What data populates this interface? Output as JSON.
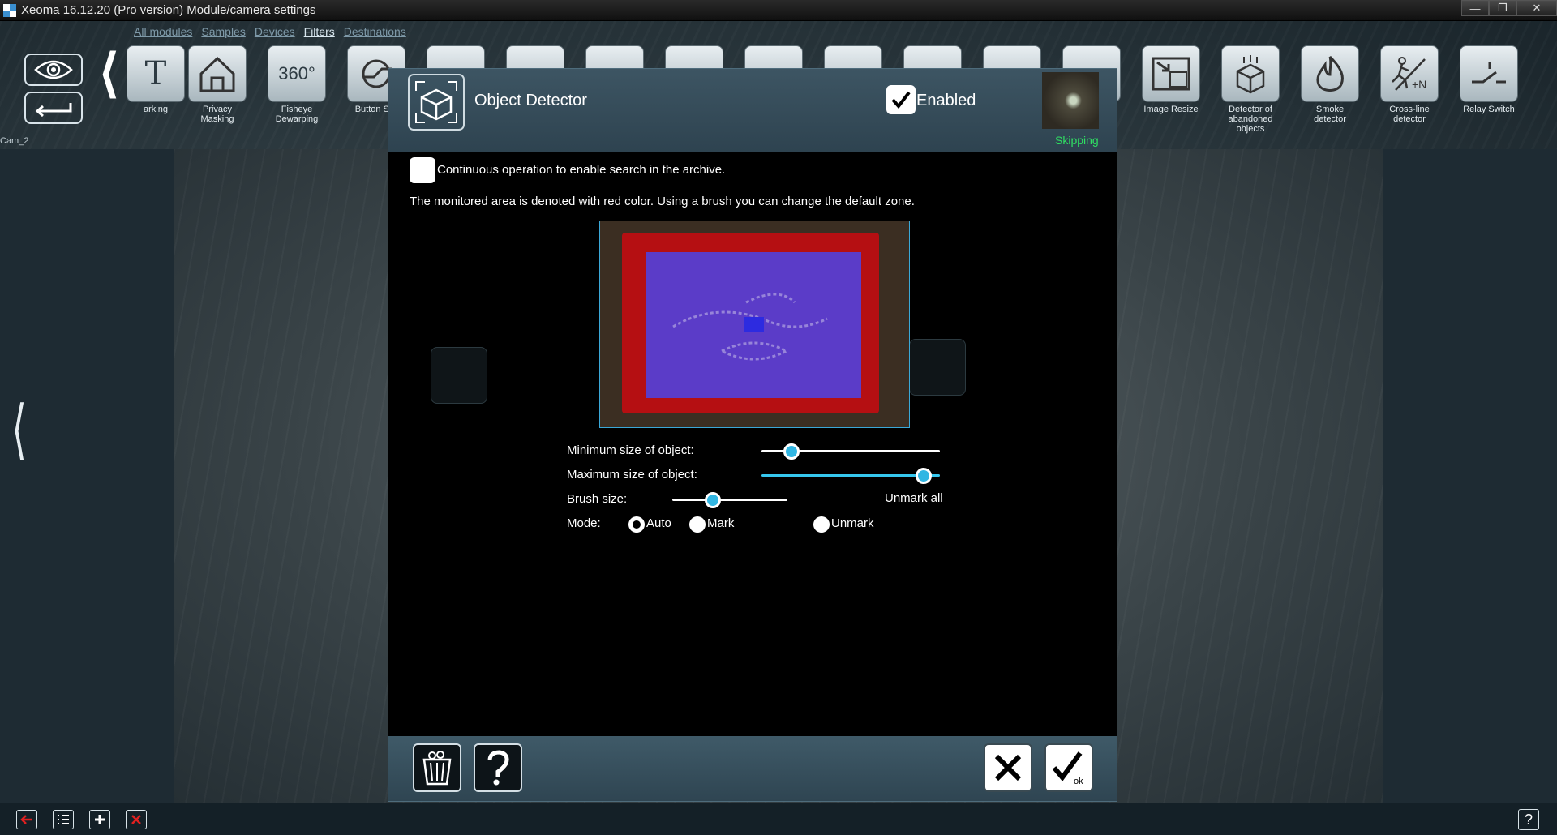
{
  "window": {
    "title": "Xeoma 16.12.20 (Pro version) Module/camera settings",
    "controls": [
      "minimize",
      "restore",
      "close"
    ]
  },
  "nav": {
    "links": [
      "All modules",
      "Samples",
      "Devices",
      "Filters",
      "Destinations"
    ],
    "active": "Filters"
  },
  "camera_label": "Cam_2",
  "modules": [
    {
      "label": "arking",
      "icon": "text-marking-icon"
    },
    {
      "label": "Privacy Masking",
      "icon": "privacy-masking-icon"
    },
    {
      "label": "Fisheye Dewarping",
      "icon": "fisheye-dewarping-icon",
      "icon_text": "360°"
    },
    {
      "label": "Button Swi",
      "icon": "button-switcher-icon"
    },
    {
      "label": "",
      "icon": "module-icon"
    },
    {
      "label": "",
      "icon": "module-icon"
    },
    {
      "label": "",
      "icon": "module-icon"
    },
    {
      "label": "",
      "icon": "module-icon"
    },
    {
      "label": "",
      "icon": "module-icon"
    },
    {
      "label": "",
      "icon": "module-icon"
    },
    {
      "label": "",
      "icon": "module-icon"
    },
    {
      "label": "",
      "icon": "module-icon"
    },
    {
      "label": "",
      "icon": "module-icon"
    },
    {
      "label": "Image Resize",
      "icon": "image-resize-icon"
    },
    {
      "label": "Detector of abandoned objects",
      "icon": "abandoned-objects-icon"
    },
    {
      "label": "Smoke detector",
      "icon": "smoke-detector-icon"
    },
    {
      "label": "Cross-line detector",
      "icon": "cross-line-icon",
      "icon_text": "+N"
    },
    {
      "label": "Relay Switch",
      "icon": "relay-switch-icon"
    }
  ],
  "dialog": {
    "title": "Object Detector",
    "enabled_label": "Enabled",
    "enabled": true,
    "status": "Skipping",
    "status_color": "#2fe062",
    "continuous_label": "Continuous operation to enable search in the archive.",
    "continuous_checked": false,
    "info_text": "The monitored area is denoted with red color. Using a brush you can change the default zone.",
    "zone_colors": {
      "monitored": "#b50f12",
      "overlay": "#5b3cc8"
    },
    "sliders": {
      "min_size": {
        "label": "Minimum size of object:",
        "value": 0.17
      },
      "max_size": {
        "label": "Maximum size of object:",
        "value": 0.91
      },
      "brush_size": {
        "label": "Brush size:",
        "value": 0.35
      }
    },
    "unmark_all": "Unmark all",
    "mode": {
      "label": "Mode:",
      "options": [
        "Auto",
        "Mark",
        "Unmark"
      ],
      "selected": "Auto"
    },
    "footer": {
      "delete_icon": "trash-icon",
      "help_icon": "question-icon",
      "cancel_icon": "close-icon",
      "ok_label": "ok"
    }
  },
  "bottom_bar": {
    "buttons": [
      "back-arrow-icon",
      "list-icon",
      "plus-icon",
      "remove-icon"
    ],
    "help": "?"
  }
}
